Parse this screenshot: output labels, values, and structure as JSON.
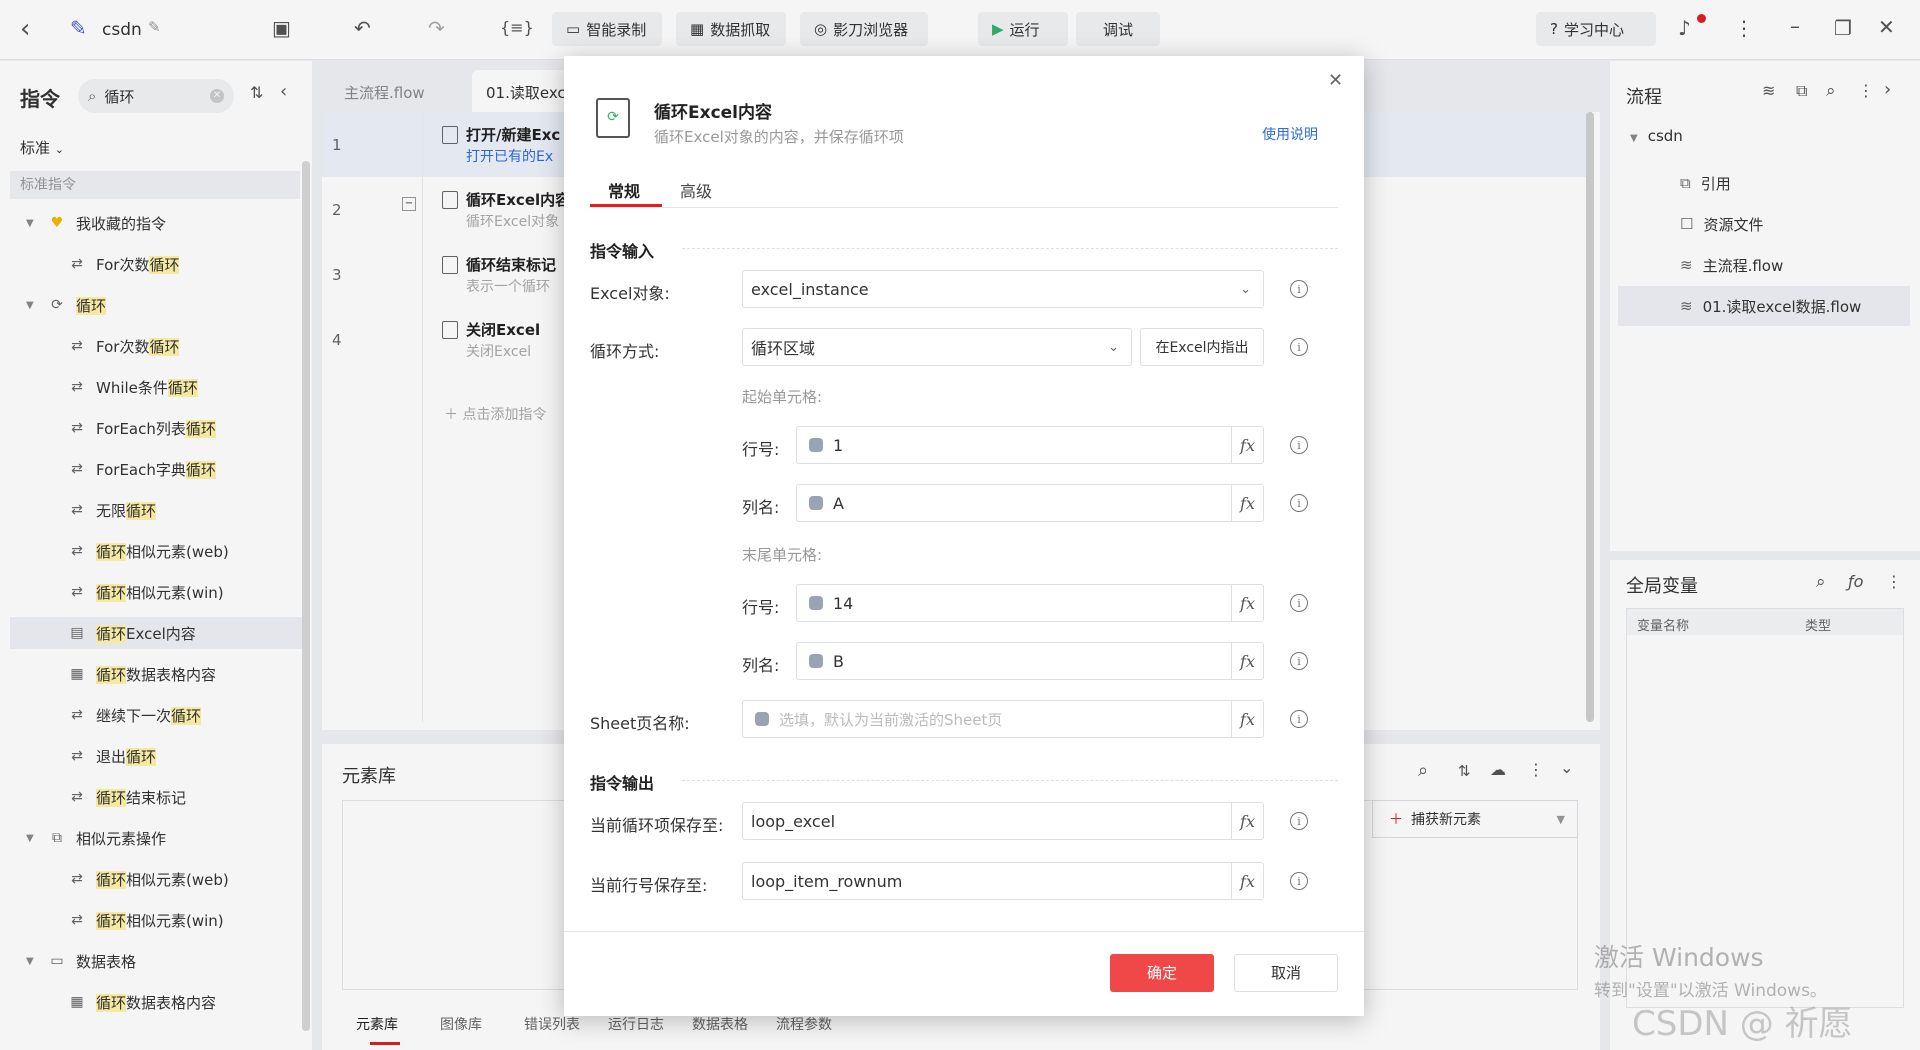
{
  "topbar": {
    "back": "‹",
    "project_name": "csdn",
    "record": "智能录制",
    "capture": "数据抓取",
    "browser": "影刀浏览器",
    "run": "运行",
    "debug": "调试",
    "help": "学习中心"
  },
  "left": {
    "title": "指令",
    "search_value": "循环",
    "filter": "标准",
    "category": "标准指令",
    "tree": [
      {
        "label": "我收藏的指令",
        "pre": "",
        "hl": "",
        "post": "",
        "level": 0,
        "icon": "heart-icon"
      },
      {
        "label": "",
        "pre": "For次数",
        "hl": "循环",
        "post": "",
        "level": 1,
        "icon": "loop-icon"
      },
      {
        "label": "",
        "pre": "",
        "hl": "循环",
        "post": "",
        "level": 0,
        "icon": "refresh-icon"
      },
      {
        "label": "",
        "pre": "For次数",
        "hl": "循环",
        "post": "",
        "level": 1,
        "icon": "loop-icon"
      },
      {
        "label": "",
        "pre": "While条件",
        "hl": "循环",
        "post": "",
        "level": 1,
        "icon": "loop-icon"
      },
      {
        "label": "",
        "pre": "ForEach列表",
        "hl": "循环",
        "post": "",
        "level": 1,
        "icon": "loop-icon"
      },
      {
        "label": "",
        "pre": "ForEach字典",
        "hl": "循环",
        "post": "",
        "level": 1,
        "icon": "loop-icon"
      },
      {
        "label": "",
        "pre": "无限",
        "hl": "循环",
        "post": "",
        "level": 1,
        "icon": "loop-icon"
      },
      {
        "label": "",
        "pre": "",
        "hl": "循环",
        "post": "相似元素(web)",
        "level": 1,
        "icon": "loop-icon"
      },
      {
        "label": "",
        "pre": "",
        "hl": "循环",
        "post": "相似元素(win)",
        "level": 1,
        "icon": "loop-icon"
      },
      {
        "label": "",
        "pre": "",
        "hl": "循环",
        "post": "Excel内容",
        "level": 1,
        "icon": "excel-icon",
        "selected": true
      },
      {
        "label": "",
        "pre": "",
        "hl": "循环",
        "post": "数据表格内容",
        "level": 1,
        "icon": "table-icon"
      },
      {
        "label": "",
        "pre": "继续下一次",
        "hl": "循环",
        "post": "",
        "level": 1,
        "icon": "loop-icon"
      },
      {
        "label": "",
        "pre": "退出",
        "hl": "循环",
        "post": "",
        "level": 1,
        "icon": "loop-icon"
      },
      {
        "label": "",
        "pre": "",
        "hl": "循环",
        "post": "结束标记",
        "level": 1,
        "icon": "loop-icon"
      },
      {
        "label": "相似元素操作",
        "pre": "",
        "hl": "",
        "post": "",
        "level": 0,
        "icon": "copy-icon"
      },
      {
        "label": "",
        "pre": "",
        "hl": "循环",
        "post": "相似元素(web)",
        "level": 1,
        "icon": "loop-icon"
      },
      {
        "label": "",
        "pre": "",
        "hl": "循环",
        "post": "相似元素(win)",
        "level": 1,
        "icon": "loop-icon"
      },
      {
        "label": "数据表格",
        "pre": "",
        "hl": "",
        "post": "",
        "level": 0,
        "icon": "doc-icon"
      },
      {
        "label": "",
        "pre": "",
        "hl": "循环",
        "post": "数据表格内容",
        "level": 1,
        "icon": "table-icon"
      }
    ]
  },
  "flow": {
    "tabs": [
      "主流程.flow",
      "01.读取exc"
    ],
    "rows": [
      {
        "num": "1",
        "title": "打开/新建Exc",
        "sub": "打开已有的Ex"
      },
      {
        "num": "2",
        "title": "循环Excel内容",
        "sub": "循环Excel对象"
      },
      {
        "num": "3",
        "title": "循环结束标记",
        "sub": "表示一个循环"
      },
      {
        "num": "4",
        "title": "关闭Excel",
        "sub": "关闭Excel"
      }
    ],
    "add": "点击添加指令"
  },
  "elements": {
    "title": "元素库",
    "capture": "捕获新元素",
    "tabs": [
      "元素库",
      "图像库",
      "错误列表",
      "运行日志",
      "数据表格",
      "流程参数"
    ]
  },
  "right": {
    "flow_title": "流程",
    "root": "csdn",
    "items": [
      "引用",
      "资源文件",
      "主流程.flow",
      "01.读取excel数据.flow"
    ],
    "vars_title": "全局变量",
    "col_name": "变量名称",
    "col_type": "类型"
  },
  "modal": {
    "title": "循环Excel内容",
    "subtitle": "循环Excel对象的内容，并保存循环项",
    "help": "使用说明",
    "tab_general": "常规",
    "tab_advanced": "高级",
    "input_section": "指令输入",
    "output_section": "指令输出",
    "excel_label": "Excel对象:",
    "excel_value": "excel_instance",
    "mode_label": "循环方式:",
    "mode_value": "循环区域",
    "point_btn": "在Excel内指出",
    "start_label": "起始单元格:",
    "row_label": "行号:",
    "col_label": "列名:",
    "start_row": "1",
    "start_col": "A",
    "end_label": "末尾单元格:",
    "end_row": "14",
    "end_col": "B",
    "sheet_label": "Sheet页名称:",
    "sheet_placeholder": "选填，默认为当前激活的Sheet页",
    "save_item_label": "当前循环项保存至:",
    "save_item_value": "loop_excel",
    "save_row_label": "当前行号保存至:",
    "save_row_value": "loop_item_rownum",
    "ok": "确定",
    "cancel": "取消"
  },
  "watermark": {
    "line1": "激活 Windows",
    "line2": "转到\"设置\"以激活 Windows。",
    "csdn": "CSDN @ 祈愿"
  }
}
